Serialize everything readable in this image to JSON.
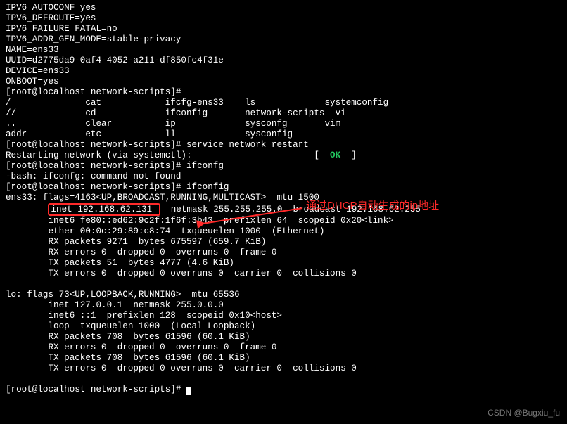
{
  "cfg": {
    "l1": "IPV6_AUTOCONF=yes",
    "l2": "IPV6_DEFROUTE=yes",
    "l3": "IPV6_FAILURE_FATAL=no",
    "l4": "IPV6_ADDR_GEN_MODE=stable-privacy",
    "l5": "NAME=ens33",
    "l6": "UUID=d2775da9-0af4-4052-a211-df850fc4f31e",
    "l7": "DEVICE=ens33",
    "l8": "ONBOOT=yes"
  },
  "prompt1": "[root@localhost network-scripts]# ",
  "tab": {
    "r1": "/              cat            ifcfg-ens33    ls             systemconfig",
    "r2": "//             cd             ifconfig       network-scripts  vi",
    "r3": "..             clear          ip             sysconfg       vim",
    "r4": "addr           etc            ll             sysconfig      "
  },
  "cmd_restart": "service network restart",
  "restart_line_pre": "Restarting network (via systemctl):                       [  ",
  "restart_ok": "OK",
  "restart_line_post": "  ]",
  "cmd_ifconfg": "ifconfg",
  "bash_err": "-bash: ifconfg: command not found",
  "cmd_ifconfig": "ifconfig",
  "ens33": {
    "hdr_pre": "ens33: flags=4163<UP,BROADCAST,",
    "hdr_mid": "RUNNING",
    "hdr_post": ",MULTICAST>  mtu 1500",
    "inet_pad": "        ",
    "inet_box": "inet 192.168.62.131 ",
    "inet_rest": "  netmask 255.255.255.0  broadcast 192.168.62.255",
    "inet6": "        inet6 fe80::ed62:9c2f:1f6f:3b43  prefixlen 64  scopeid 0x20<link>",
    "ether": "        ether 00:0c:29:89:c8:74  txqueuelen 1000  (Ethernet)",
    "rxp": "        RX packets 9271  bytes 675597 (659.7 KiB)",
    "rxe": "        RX errors 0  dropped 0  overruns 0  frame 0",
    "txp": "        TX packets 51  bytes 4777 (4.6 KiB)",
    "txe": "        TX errors 0  dropped 0 overruns 0  carrier 0  collisions 0"
  },
  "blank": " ",
  "lo": {
    "hdr": "lo: flags=73<UP,LOOPBACK,RUNNING>  mtu 65536",
    "inet": "        inet 127.0.0.1  netmask 255.0.0.0",
    "inet6": "        inet6 ::1  prefixlen 128  scopeid 0x10<host>",
    "loop": "        loop  txqueuelen 1000  (Local Loopback)",
    "rxp": "        RX packets 708  bytes 61596 (60.1 KiB)",
    "rxe": "        RX errors 0  dropped 0  overruns 0  frame 0",
    "txp": "        TX packets 708  bytes 61596 (60.1 KiB)",
    "txe": "        TX errors 0  dropped 0 overruns 0  carrier 0  collisions 0"
  },
  "annotation": "通过DHCP自动生成的ip地址",
  "watermark": "CSDN @Bugxiu_fu"
}
